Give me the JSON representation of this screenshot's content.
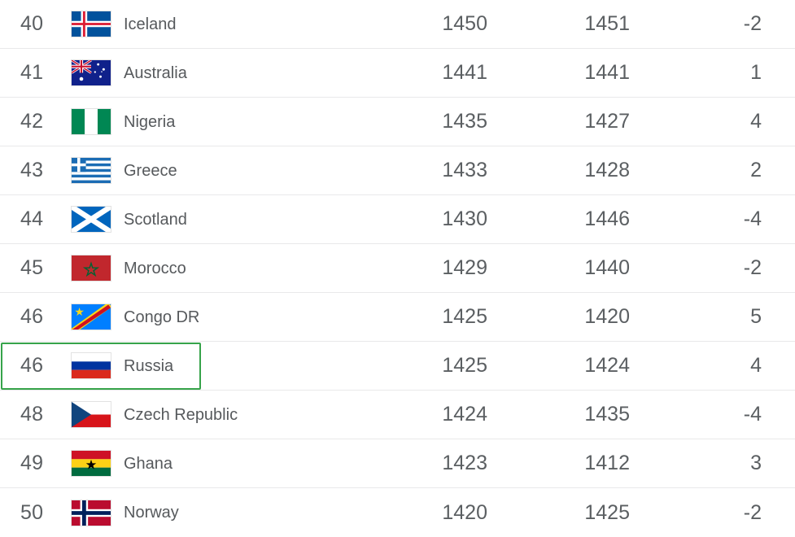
{
  "table": {
    "columns": [
      "rank",
      "flag",
      "country",
      "points",
      "previous_points",
      "change"
    ],
    "rows": [
      {
        "rank": "40",
        "country": "Iceland",
        "flag": "flag-iceland",
        "points": "1450",
        "previous": "1451",
        "change": "-2",
        "highlighted": false
      },
      {
        "rank": "41",
        "country": "Australia",
        "flag": "flag-australia",
        "points": "1441",
        "previous": "1441",
        "change": "1",
        "highlighted": false
      },
      {
        "rank": "42",
        "country": "Nigeria",
        "flag": "flag-nigeria",
        "points": "1435",
        "previous": "1427",
        "change": "4",
        "highlighted": false
      },
      {
        "rank": "43",
        "country": "Greece",
        "flag": "flag-greece",
        "points": "1433",
        "previous": "1428",
        "change": "2",
        "highlighted": false
      },
      {
        "rank": "44",
        "country": "Scotland",
        "flag": "flag-scotland",
        "points": "1430",
        "previous": "1446",
        "change": "-4",
        "highlighted": false
      },
      {
        "rank": "45",
        "country": "Morocco",
        "flag": "flag-morocco",
        "points": "1429",
        "previous": "1440",
        "change": "-2",
        "highlighted": false
      },
      {
        "rank": "46",
        "country": "Congo DR",
        "flag": "flag-congo-dr",
        "points": "1425",
        "previous": "1420",
        "change": "5",
        "highlighted": false
      },
      {
        "rank": "46",
        "country": "Russia",
        "flag": "flag-russia",
        "points": "1425",
        "previous": "1424",
        "change": "4",
        "highlighted": true
      },
      {
        "rank": "48",
        "country": "Czech Republic",
        "flag": "flag-czech",
        "points": "1424",
        "previous": "1435",
        "change": "-4",
        "highlighted": false
      },
      {
        "rank": "49",
        "country": "Ghana",
        "flag": "flag-ghana",
        "points": "1423",
        "previous": "1412",
        "change": "3",
        "highlighted": false
      },
      {
        "rank": "50",
        "country": "Norway",
        "flag": "flag-norway",
        "points": "1420",
        "previous": "1425",
        "change": "-2",
        "highlighted": false
      }
    ]
  },
  "colors": {
    "highlight_border": "#36a34a",
    "text": "#56595c",
    "rank_text": "#5b5f62",
    "row_divider": "#e9e9ea",
    "background": "#ffffff"
  }
}
